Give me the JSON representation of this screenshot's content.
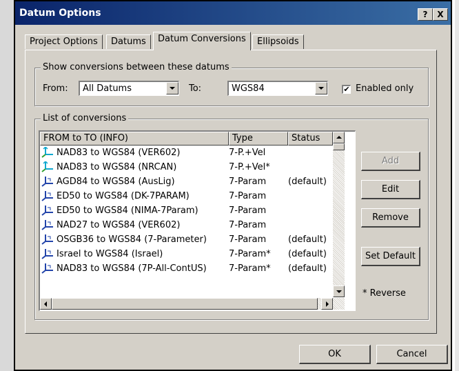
{
  "window": {
    "title": "Datum Options",
    "help_button": "?",
    "close_button": "X"
  },
  "tabs": [
    {
      "label": "Project Options",
      "active": false
    },
    {
      "label": "Datums",
      "active": false
    },
    {
      "label": "Datum Conversions",
      "active": true
    },
    {
      "label": "Ellipsoids",
      "active": false
    }
  ],
  "show_group": {
    "label": "Show conversions between these datums",
    "from_label": "From:",
    "from_value": "All Datums",
    "to_label": "To:",
    "to_value": "WGS84",
    "enabled_only_label": "Enabled only",
    "enabled_only_checked": true
  },
  "list_group": {
    "label": "List of conversions",
    "columns": [
      "FROM to TO (INFO)",
      "Type",
      "Status"
    ],
    "rows": [
      {
        "name": "NAD83 to WGS84 (VER602)",
        "type": "7-P.+Vel",
        "status": "",
        "icon": "velocity-axes-icon"
      },
      {
        "name": "NAD83 to WGS84 (NRCAN)",
        "type": "7-P.+Vel*",
        "status": "",
        "icon": "velocity-axes-icon"
      },
      {
        "name": "AGD84 to WGS84 (AusLig)",
        "type": "7-Param",
        "status": "(default)",
        "icon": "axes-icon"
      },
      {
        "name": "ED50 to WGS84 (DK-7PARAM)",
        "type": "7-Param",
        "status": "",
        "icon": "axes-icon"
      },
      {
        "name": "ED50 to WGS84 (NIMA-7Param)",
        "type": "7-Param",
        "status": "",
        "icon": "axes-icon"
      },
      {
        "name": "NAD27 to WGS84 (VER602)",
        "type": "7-Param",
        "status": "",
        "icon": "axes-icon"
      },
      {
        "name": "OSGB36 to WGS84 (7-Parameter)",
        "type": "7-Param",
        "status": "(default)",
        "icon": "axes-icon"
      },
      {
        "name": "Israel to WGS84 (Israel)",
        "type": "7-Param*",
        "status": "(default)",
        "icon": "axes-icon"
      },
      {
        "name": "NAD83 to WGS84 (7P-All-ContUS)",
        "type": "7-Param*",
        "status": "(default)",
        "icon": "axes-icon"
      }
    ]
  },
  "side_buttons": {
    "add": "Add",
    "edit": "Edit",
    "remove": "Remove",
    "set_default": "Set Default"
  },
  "reverse_note": "* Reverse",
  "footer": {
    "ok": "OK",
    "cancel": "Cancel"
  },
  "colors": {
    "titlebar_start": "#0a246a",
    "titlebar_end": "#3a6ea5",
    "dialog_bg": "#d4d0c8",
    "icon_blue": "#2244aa",
    "icon_cyan": "#10a8d0",
    "icon_green": "#30a030"
  }
}
